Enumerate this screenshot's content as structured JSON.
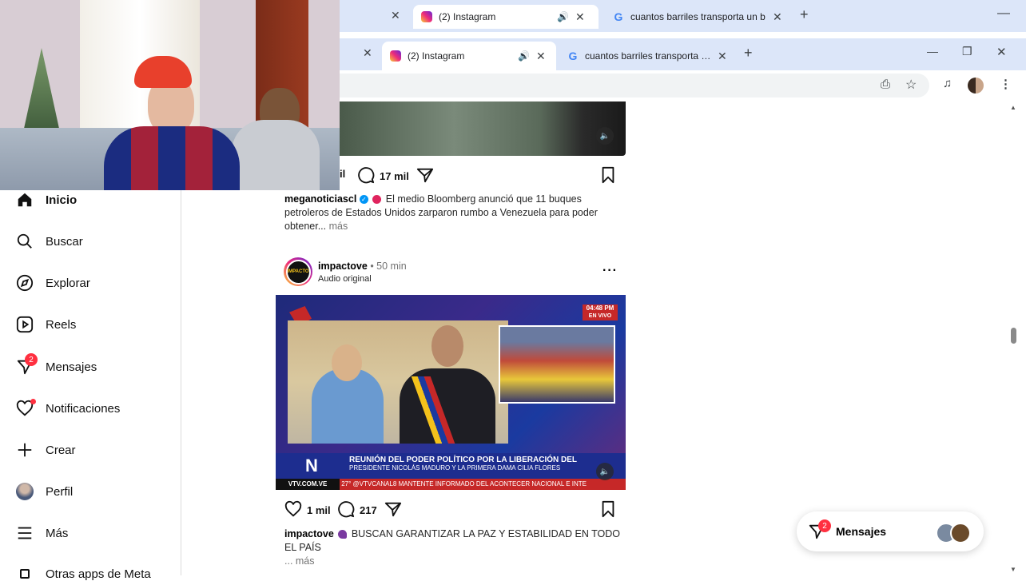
{
  "outer_tabs": [
    {
      "title": "(2) Instagram",
      "favicon": "instagram-icon"
    },
    {
      "title": "cuantos barriles transporta un b",
      "favicon": "google-icon"
    }
  ],
  "inner_tabs": [
    {
      "title": "(2) Instagram",
      "favicon": "instagram-icon"
    },
    {
      "title": "cuantos barriles transporta un b",
      "favicon": "google-icon"
    }
  ],
  "sidebar": {
    "items": [
      {
        "label": "Inicio",
        "icon": "home-icon"
      },
      {
        "label": "Buscar",
        "icon": "search-icon"
      },
      {
        "label": "Explorar",
        "icon": "compass-icon"
      },
      {
        "label": "Reels",
        "icon": "reels-icon"
      },
      {
        "label": "Mensajes",
        "icon": "messenger-icon",
        "badge": "2"
      },
      {
        "label": "Notificaciones",
        "icon": "heart-icon"
      },
      {
        "label": "Crear",
        "icon": "plus-icon"
      },
      {
        "label": "Perfil",
        "icon": "avatar-icon"
      },
      {
        "label": "Más",
        "icon": "menu-icon"
      },
      {
        "label": "Otras apps de Meta",
        "icon": "meta-icon"
      }
    ]
  },
  "post1": {
    "likes_partial": "il",
    "comments": "17 mil",
    "username": "meganoticiascl",
    "caption": "El medio Bloomberg anunció que 11 buques petroleros de Estados Unidos zarparon rumbo a Venezuela para poder obtener...",
    "more": "más"
  },
  "post2": {
    "username": "impactove",
    "time": "• 50 min",
    "audio": "Audio original",
    "avatar_text": "IMPACTO",
    "video": {
      "time_badge": "04:48 PM",
      "live": "EN VIVO",
      "headline": "REUNIÓN DEL PODER POLÍTICO POR LA LIBERACIÓN DEL",
      "subheadline": "PRESIDENTE NICOLÁS MADURO Y LA PRIMERA DAMA CILIA FLORES",
      "logo_letter": "N",
      "site": "VTV.COM.VE",
      "ticker": "27° @VTVCANAL8 MANTENTE INFORMADO DEL ACONTECER NACIONAL E INTE"
    },
    "likes": "1 mil",
    "comments": "217",
    "caption_user": "impactove",
    "caption": "BUSCAN GARANTIZAR LA PAZ Y ESTABILIDAD EN TODO EL PAÍS",
    "more": "... más"
  },
  "messages_pill": {
    "label": "Mensajes",
    "badge": "2"
  },
  "colors": {
    "tabbar_bg": "#dce6f9",
    "badge_red": "#ff3040",
    "verified_blue": "#0095f6",
    "video_banner_blue": "#1d2d8f"
  }
}
